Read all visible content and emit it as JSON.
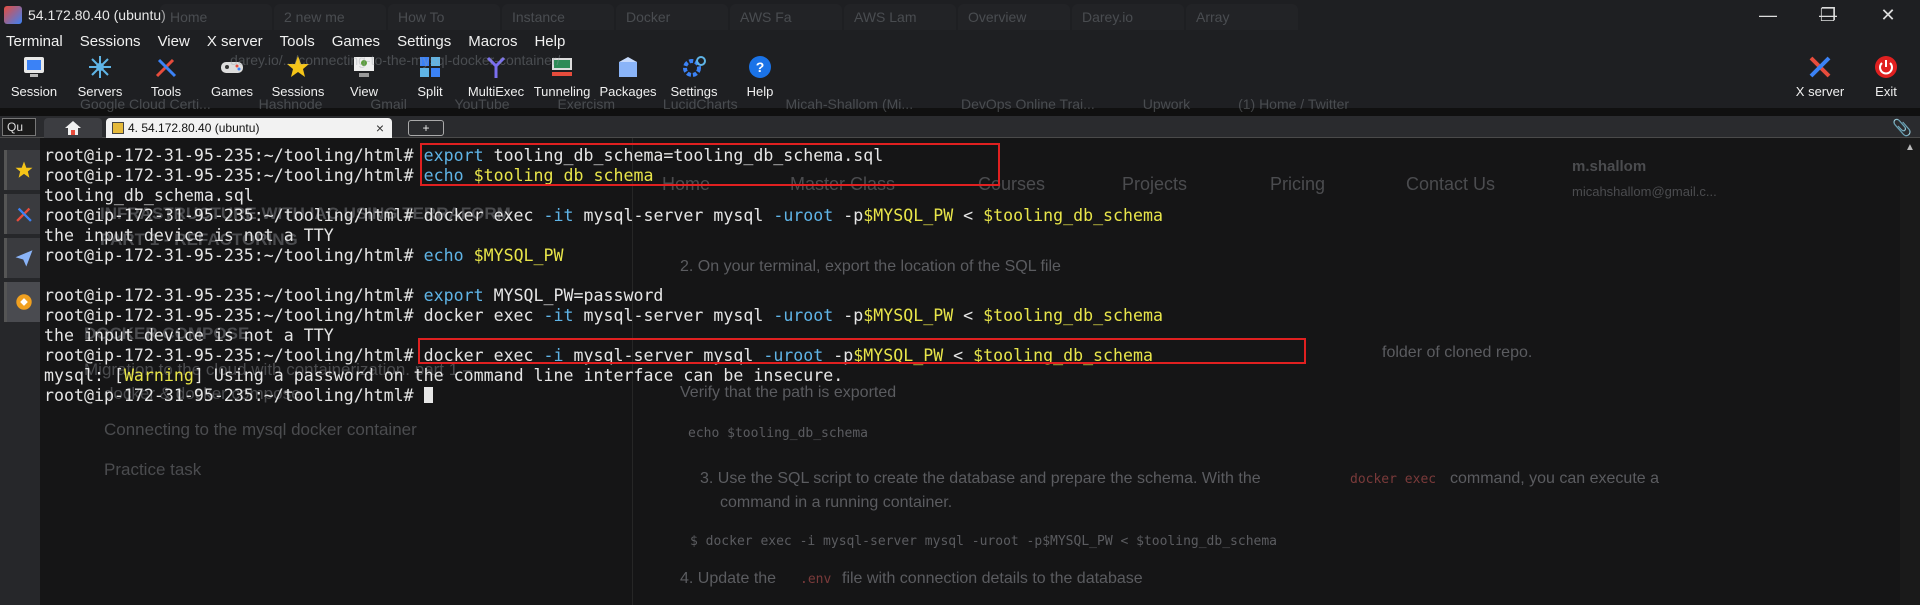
{
  "window": {
    "title": "54.172.80.40 (ubuntu)",
    "controls": {
      "minimize": "—",
      "maximize": "❐",
      "close": "✕"
    }
  },
  "background_browser": {
    "tabs": [
      "Home",
      "2 new me",
      "How To",
      "Instance",
      "Docker",
      "AWS Fa",
      "AWS Lam",
      "Overview",
      "Darey.io",
      "Array"
    ],
    "url": "darey.io/.../connecting-to-the-mysql-docker-container/",
    "bookmarks": [
      "Google Cloud Certi...",
      "Hashnode",
      "Gmail",
      "YouTube",
      "Exercism",
      "LucidCharts",
      "Micah-Shallom (Mi...",
      "DevOps Online Trai...",
      "Upwork",
      "(1) Home / Twitter"
    ],
    "nav": [
      "Home",
      "Master Class",
      "Courses",
      "Projects",
      "Pricing",
      "Contact Us"
    ],
    "user_name": "m.shallom",
    "user_email": "micahshallom@gmail.c...",
    "sidebar_heading_1": "INFRASTRUCTURE WITH IAC USING TERRAFORM",
    "sidebar_heading_2": "PART 1 - REFACTORING",
    "sidebar_heading_3": "DOCKER COMPOSE",
    "sidebar_items": [
      "Migration to the cloud with containerization. part 1 –",
      "docker & docker compose",
      "Connecting to the mysql docker container",
      "Practice task"
    ],
    "step_2": "2. On your terminal, export the location of the SQL file",
    "step_2_folder": "folder of cloned repo.",
    "verify": "Verify that the path is exported",
    "code_echo": "echo $tooling_db_schema",
    "step_3a": "3. Use the SQL script to create the database and prepare the schema. With the",
    "step_3_code": "docker exec",
    "step_3b": "command, you can execute a",
    "step_3c": "command in a running container.",
    "code_exec": "$ docker exec -i mysql-server mysql -uroot -p$MYSQL_PW < $tooling_db_schema",
    "step_4a": "4. Update the",
    "step_4_code": ".env",
    "step_4b": "file with connection details to the database"
  },
  "menu": [
    "Terminal",
    "Sessions",
    "View",
    "X server",
    "Tools",
    "Games",
    "Settings",
    "Macros",
    "Help"
  ],
  "toolbar": {
    "buttons": [
      {
        "label": "Session",
        "icon": "session-icon"
      },
      {
        "label": "Servers",
        "icon": "servers-icon"
      },
      {
        "label": "Tools",
        "icon": "tools-icon"
      },
      {
        "label": "Games",
        "icon": "games-icon"
      },
      {
        "label": "Sessions",
        "icon": "sessions-star-icon"
      },
      {
        "label": "View",
        "icon": "view-icon"
      },
      {
        "label": "Split",
        "icon": "split-icon"
      },
      {
        "label": "MultiExec",
        "icon": "multiexec-icon"
      },
      {
        "label": "Tunneling",
        "icon": "tunneling-icon"
      },
      {
        "label": "Packages",
        "icon": "packages-icon"
      },
      {
        "label": "Settings",
        "icon": "settings-icon"
      },
      {
        "label": "Help",
        "icon": "help-icon"
      }
    ],
    "xserver_label": "X server",
    "exit_label": "Exit"
  },
  "tabbar": {
    "quick_connect": "Qu",
    "session_tab": "4. 54.172.80.40 (ubuntu)",
    "close": "×",
    "new_tab": "+"
  },
  "terminal": {
    "prompt": "root@ip-172-31-95-235:~/tooling/html#",
    "lines": [
      {
        "cmd": "export",
        "arg": " tooling_db_schema=tooling_db_schema.sql"
      },
      {
        "cmd": "echo",
        "var": "$tooling_db_schema"
      },
      {
        "output": "tooling_db_schema.sql"
      },
      {
        "a": "docker exec ",
        "flag1": "-it",
        "b": " mysql-server mysql ",
        "flag2": "-uroot",
        "c": " -p",
        "var1": "$MYSQL_PW",
        "d": " < ",
        "var2": "$tooling_db_schema"
      },
      {
        "output": "the input device is not a TTY"
      },
      {
        "cmd": "echo",
        "var": "$MYSQL_PW"
      },
      {
        "output": ""
      },
      {
        "cmd": "export",
        "arg": " MYSQL_PW=password"
      },
      {
        "a": "docker exec ",
        "flag1": "-it",
        "b": " mysql-server mysql ",
        "flag2": "-uroot",
        "c": " -p",
        "var1": "$MYSQL_PW",
        "d": " < ",
        "var2": "$tooling_db_schema"
      },
      {
        "output": "the input device is not a TTY"
      },
      {
        "a": "docker exec ",
        "flag1": "-i",
        "b": " mysql-server mysql ",
        "flag2": "-uroot",
        "c": " -p",
        "var1": "$MYSQL_PW",
        "d": " < ",
        "var2": "$tooling_db_schema"
      },
      {
        "warn_pre": "mysql: [",
        "warn_word": "Warning",
        "warn_post": "] Using a password on the command line interface can be insecure."
      }
    ]
  },
  "colors": {
    "terminal_bg": "#101010",
    "terminal_fg": "#e6e6e6",
    "command_blue": "#5fb4e6",
    "variable_yellow": "#e8e54a",
    "highlight_red": "#e02020"
  }
}
